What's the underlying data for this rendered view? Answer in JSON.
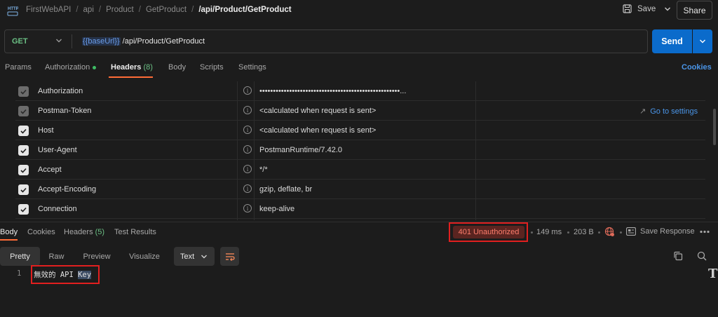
{
  "app": {
    "icon_text": "HTTP",
    "breadcrumb": [
      "FirstWebAPI",
      "api",
      "Product",
      "GetProduct"
    ],
    "current_request": "/api/Product/GetProduct",
    "save_label": "Save",
    "share_label": "Share"
  },
  "request": {
    "method": "GET",
    "url_variable": "{{baseUrl}}",
    "url_path": " /api/Product/GetProduct",
    "send_label": "Send",
    "tabs": {
      "params": "Params",
      "authorization": "Authorization",
      "headers": "Headers",
      "headers_count": "(8)",
      "body": "Body",
      "scripts": "Scripts",
      "settings": "Settings"
    },
    "cookies_label": "Cookies",
    "go_to_settings": "Go to settings",
    "headers": [
      {
        "key": "Authorization",
        "value": "••••••••••••••••••••••••••••••••••••••••••••••••••••...",
        "enabled": true,
        "locked": true
      },
      {
        "key": "Postman-Token",
        "value": "<calculated when request is sent>",
        "enabled": true,
        "locked": true
      },
      {
        "key": "Host",
        "value": "<calculated when request is sent>",
        "enabled": true,
        "locked": false
      },
      {
        "key": "User-Agent",
        "value": "PostmanRuntime/7.42.0",
        "enabled": true,
        "locked": false
      },
      {
        "key": "Accept",
        "value": "*/*",
        "enabled": true,
        "locked": false
      },
      {
        "key": "Accept-Encoding",
        "value": "gzip, deflate, br",
        "enabled": true,
        "locked": false
      },
      {
        "key": "Connection",
        "value": "keep-alive",
        "enabled": true,
        "locked": false
      }
    ]
  },
  "response": {
    "tabs": {
      "body": "Body",
      "cookies": "Cookies",
      "headers": "Headers",
      "headers_count": "(5)",
      "test_results": "Test Results"
    },
    "status": "401 Unauthorized",
    "time": "149 ms",
    "size": "203 B",
    "save_response": "Save Response",
    "view_tabs": [
      "Pretty",
      "Raw",
      "Preview",
      "Visualize"
    ],
    "format": "Text",
    "line_number": "1",
    "body_text_prefix": "無效的 API ",
    "body_text_selected": "Key"
  },
  "colors": {
    "accent": "#ff6c37",
    "send": "#0b6bcb",
    "method_get": "#6bbf84",
    "status_error": "#ff7e6d",
    "highlight_box": "#e11f1f"
  }
}
